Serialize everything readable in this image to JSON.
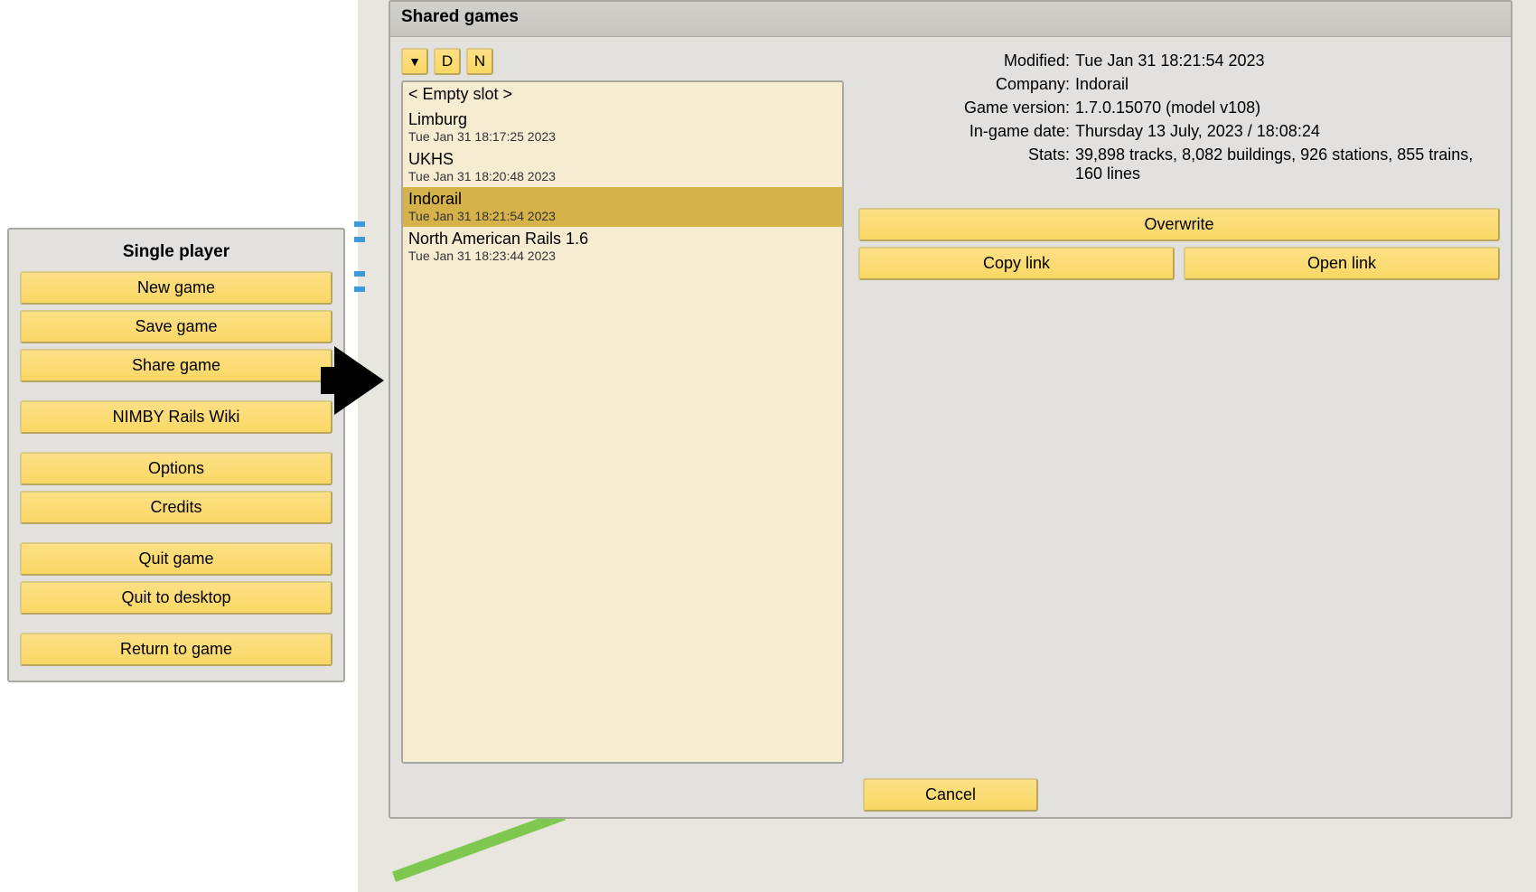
{
  "single_player": {
    "title": "Single player",
    "new_game": "New game",
    "save_game": "Save game",
    "share_game": "Share game",
    "wiki": "NIMBY Rails Wiki",
    "options": "Options",
    "credits": "Credits",
    "quit_game": "Quit game",
    "quit_desktop": "Quit to desktop",
    "return": "Return to game"
  },
  "shared": {
    "title": "Shared games",
    "sort_d": "D",
    "sort_n": "N",
    "list": [
      {
        "name": "< Empty slot >",
        "date": ""
      },
      {
        "name": "Limburg",
        "date": "Tue Jan 31 18:17:25 2023"
      },
      {
        "name": "UKHS",
        "date": "Tue Jan 31 18:20:48 2023"
      },
      {
        "name": "Indorail",
        "date": "Tue Jan 31 18:21:54 2023"
      },
      {
        "name": "North American Rails 1.6",
        "date": "Tue Jan 31 18:23:44 2023"
      }
    ],
    "details": {
      "modified_label": "Modified:",
      "modified_value": "Tue Jan 31 18:21:54 2023",
      "company_label": "Company:",
      "company_value": "Indorail",
      "version_label": "Game version:",
      "version_value": "1.7.0.15070 (model v108)",
      "ingame_label": "In-game date:",
      "ingame_value": "Thursday 13 July, 2023 / 18:08:24",
      "stats_label": "Stats:",
      "stats_value": "39,898 tracks, 8,082 buildings, 926 stations, 855 trains, 160 lines"
    },
    "overwrite": "Overwrite",
    "copy_link": "Copy link",
    "open_link": "Open link",
    "cancel": "Cancel"
  }
}
